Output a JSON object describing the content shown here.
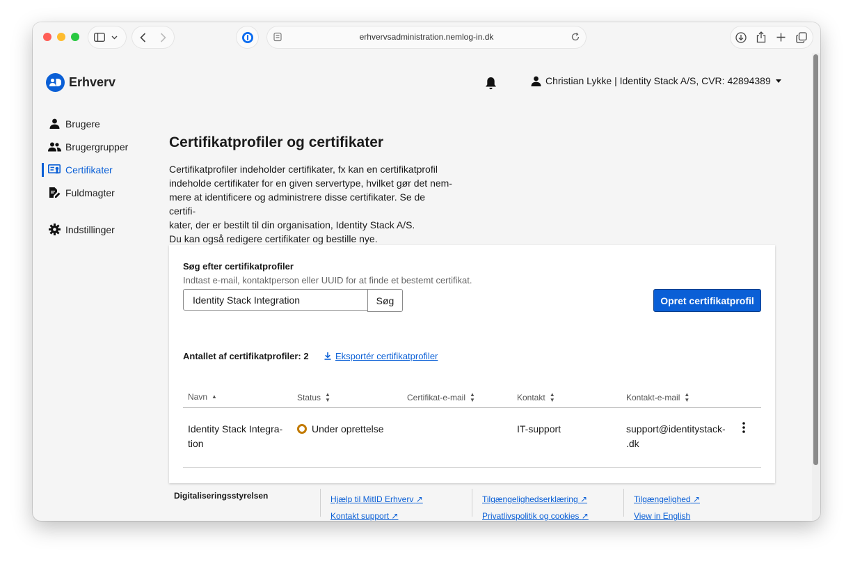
{
  "browser": {
    "url": "erhvervsadministration.nemlog-in.dk"
  },
  "header": {
    "logo_text": "Erhverv",
    "user_label": "Christian Lykke | Identity Stack A/S, CVR: 42894389"
  },
  "sidebar": {
    "items": [
      {
        "label": "Brugere"
      },
      {
        "label": "Brugergrupper"
      },
      {
        "label": "Certifikater"
      },
      {
        "label": "Fuldmagter"
      },
      {
        "label": "Indstillinger"
      }
    ]
  },
  "main": {
    "title": "Certifikatprofiler og certifikater",
    "intro_lines": [
      "Certifikatprofiler indeholder certifikater, fx kan en certifikatprofil",
      "indeholde certifikater for en given servertype, hvilket gør det nem-",
      "mere at identificere og administrere disse certifikater. Se de certifi-",
      "kater, der er bestilt til din organisation, Identity Stack A/S.",
      "Du kan også redigere certifikater og bestille nye."
    ],
    "search": {
      "label": "Søg efter certifikatprofiler",
      "hint": "Indtast e-mail, kontaktperson eller UUID for at finde et bestemt certifikat.",
      "value": "Identity Stack Integration",
      "button": "Søg"
    },
    "create_button": "Opret certifikatprofil",
    "count_label": "Antallet af certifikatprofiler: 2",
    "export_label": "Eksportér certifikatprofiler",
    "table": {
      "columns": [
        "Navn",
        "Status",
        "Certifikat-e-mail",
        "Kontakt",
        "Kontakt-e-mail"
      ],
      "rows": [
        {
          "name_line1": "Identity Stack Integra-",
          "name_line2": "tion",
          "status": "Under oprettelse",
          "cert_email": "",
          "contact": "IT-support",
          "contact_email_line1": "support@identitystack-",
          "contact_email_line2": ".dk"
        }
      ]
    }
  },
  "footer": {
    "org": "Digitaliseringsstyrelsen",
    "col1": [
      "Hjælp til MitID Erhverv",
      "Kontakt support"
    ],
    "col2": [
      "Tilgængelighedserklæring",
      "Privatlivspolitik og cookies"
    ],
    "col3": [
      "Tilgængelighed",
      "View in English"
    ]
  },
  "colors": {
    "accent": "#0a5fd6",
    "status_pending": "#c27a00"
  }
}
